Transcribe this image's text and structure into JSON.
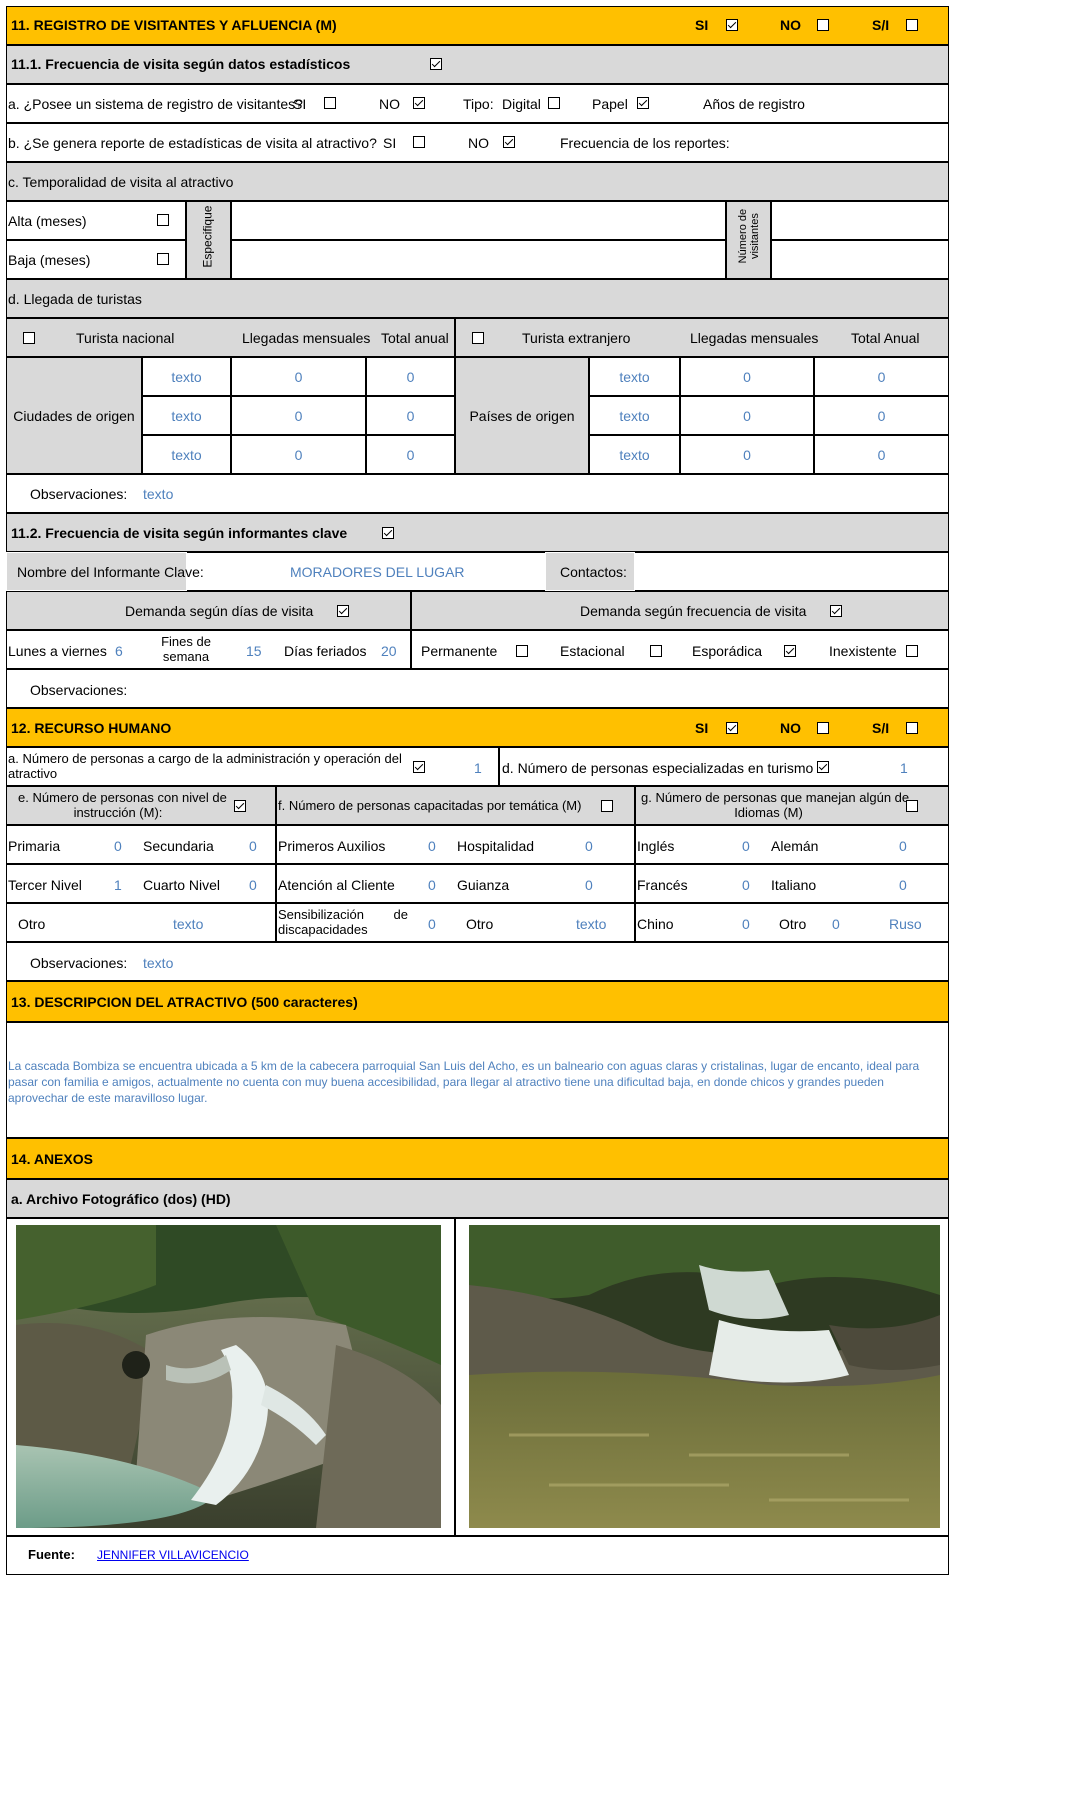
{
  "s11": {
    "title": "11. REGISTRO DE VISITANTES Y AFLUENCIA (M)",
    "si": "SI",
    "no": "NO",
    "sn": "S/I",
    "s111": "11.1. Frecuencia de visita según datos estadísticos",
    "a_q": "a. ¿Posee un sistema de registro de visitantes?",
    "tipo": "Tipo:",
    "digital": "Digital",
    "papel": "Papel",
    "anios": "Años de registro",
    "b_q": "b. ¿Se genera reporte de estadísticas de visita al atractivo?",
    "frec_rep": "Frecuencia de los reportes:",
    "c_q": "c. Temporalidad de visita al atractivo",
    "alta": "Alta (meses)",
    "baja": "Baja (meses)",
    "especifique": "Especifique",
    "num_vis_1": "Número de",
    "num_vis_2": "visitantes",
    "d_q": "d. Llegada de turistas",
    "nacional": "Turista nacional",
    "extranjero": "Turista extranjero",
    "llegadas": "Llegadas mensuales",
    "total_anual": "Total anual",
    "total_anual2": "Total Anual",
    "ciudades": "Ciudades de origen",
    "paises": "Países de origen",
    "rows": [
      {
        "a": "texto",
        "b": "0",
        "c": "0",
        "d": "texto",
        "e": "0",
        "f": "0"
      },
      {
        "a": "texto",
        "b": "0",
        "c": "0",
        "d": "texto",
        "e": "0",
        "f": "0"
      },
      {
        "a": "texto",
        "b": "0",
        "c": "0",
        "d": "texto",
        "e": "0",
        "f": "0"
      }
    ],
    "obs_label": "Observaciones:",
    "obs_val": "texto",
    "s112": "11.2. Frecuencia de visita según informantes clave",
    "nombre_label": "Nombre del Informante Clave:",
    "nombre_val": "MORADORES DEL LUGAR",
    "contactos": "Contactos:",
    "dem_dias": "Demanda según  días de visita",
    "dem_frec": "Demanda según frecuencia de visita",
    "lunes": "Lunes a viernes",
    "lunes_val": "6",
    "fines_1": "Fines de",
    "fines_2": "semana",
    "fines_val": "15",
    "feriados": "Días feriados",
    "feriados_val": "20",
    "permanente": "Permanente",
    "estacional": "Estacional",
    "esporadica": "Esporádica",
    "inexistente": "Inexistente",
    "obs2_label": "Observaciones:"
  },
  "s12": {
    "title": "12. RECURSO HUMANO",
    "a_1": "a. Número de personas a cargo de la administración y operación del",
    "a_2": "atractivo",
    "a_val": "1",
    "d_q": "d. Número de personas especializadas en turismo",
    "d_val": "1",
    "e_1": "e. Número de personas con nivel de",
    "e_2": "instrucción (M):",
    "f_q": "f. Número de personas capacitadas por temática (M)",
    "g_1": "g. Número de personas que manejan algún de",
    "g_2": "Idiomas (M)",
    "primaria": "Primaria",
    "primaria_v": "0",
    "secundaria": "Secundaria",
    "secundaria_v": "0",
    "tercer": "Tercer Nivel",
    "tercer_v": "1",
    "cuarto": "Cuarto Nivel",
    "cuarto_v": "0",
    "otro": "Otro",
    "otro_v": "texto",
    "aux": "Primeros Auxilios",
    "aux_v": "0",
    "hosp": "Hospitalidad",
    "hosp_v": "0",
    "aten": "Atención al Cliente",
    "aten_v": "0",
    "guia": "Guianza",
    "guia_v": "0",
    "sens_1": "Sensibilización",
    "sens_de": "de",
    "sens_2": "discapacidades",
    "sens_v": "0",
    "otro2": "Otro",
    "otro2_v": "texto",
    "ingles": "Inglés",
    "ingles_v": "0",
    "aleman": "Alemán",
    "aleman_v": "0",
    "frances": "Francés",
    "frances_v": "0",
    "italiano": "Italiano",
    "italiano_v": "0",
    "chino": "Chino",
    "chino_v": "0",
    "otro3": "Otro",
    "otro3_v": "0",
    "ruso": "Ruso",
    "obs_label": "Observaciones:",
    "obs_val": "texto"
  },
  "s13": {
    "title": "13. DESCRIPCION DEL ATRACTIVO (500 caracteres)",
    "line1": "La cascada Bombiza se encuentra ubicada a 5 km de la cabecera parroquial San Luis del Acho, es un balneario con aguas claras y cristalinas,  lugar de encanto, ideal para",
    "line2": "pasar con familia e amigos, actualmente no cuenta con muy buena accesibilidad, para llegar al atractivo tiene una dificultad baja, en donde chicos y grandes pueden",
    "line3": "aprovechar de este maravilloso lugar."
  },
  "s14": {
    "title": "14. ANEXOS",
    "archivo": "a. Archivo Fotográfico (dos) (HD)",
    "fuente_label": "Fuente:",
    "fuente_val": "JENNIFER VILLAVICENCIO"
  },
  "colors": {
    "header": "#ffc000",
    "gray": "#d9d9d9",
    "blue_text": "#4f81bd"
  },
  "checkboxes": {
    "s11_si": true,
    "s11_no": false,
    "s11_sn": false,
    "s111": true,
    "a_si": false,
    "a_no": true,
    "digital": false,
    "papel": true,
    "b_si": false,
    "b_no": true,
    "alta": false,
    "baja": false,
    "nacional": false,
    "extranjero": false,
    "s112": true,
    "dem_dias": true,
    "dem_frec": true,
    "permanente": false,
    "estacional": false,
    "esporadica": true,
    "inexistente": false,
    "s12_si": true,
    "s12_no": false,
    "s12_sn": false,
    "a12": true,
    "d12": true,
    "e12": true,
    "f12": false,
    "g12": false
  }
}
